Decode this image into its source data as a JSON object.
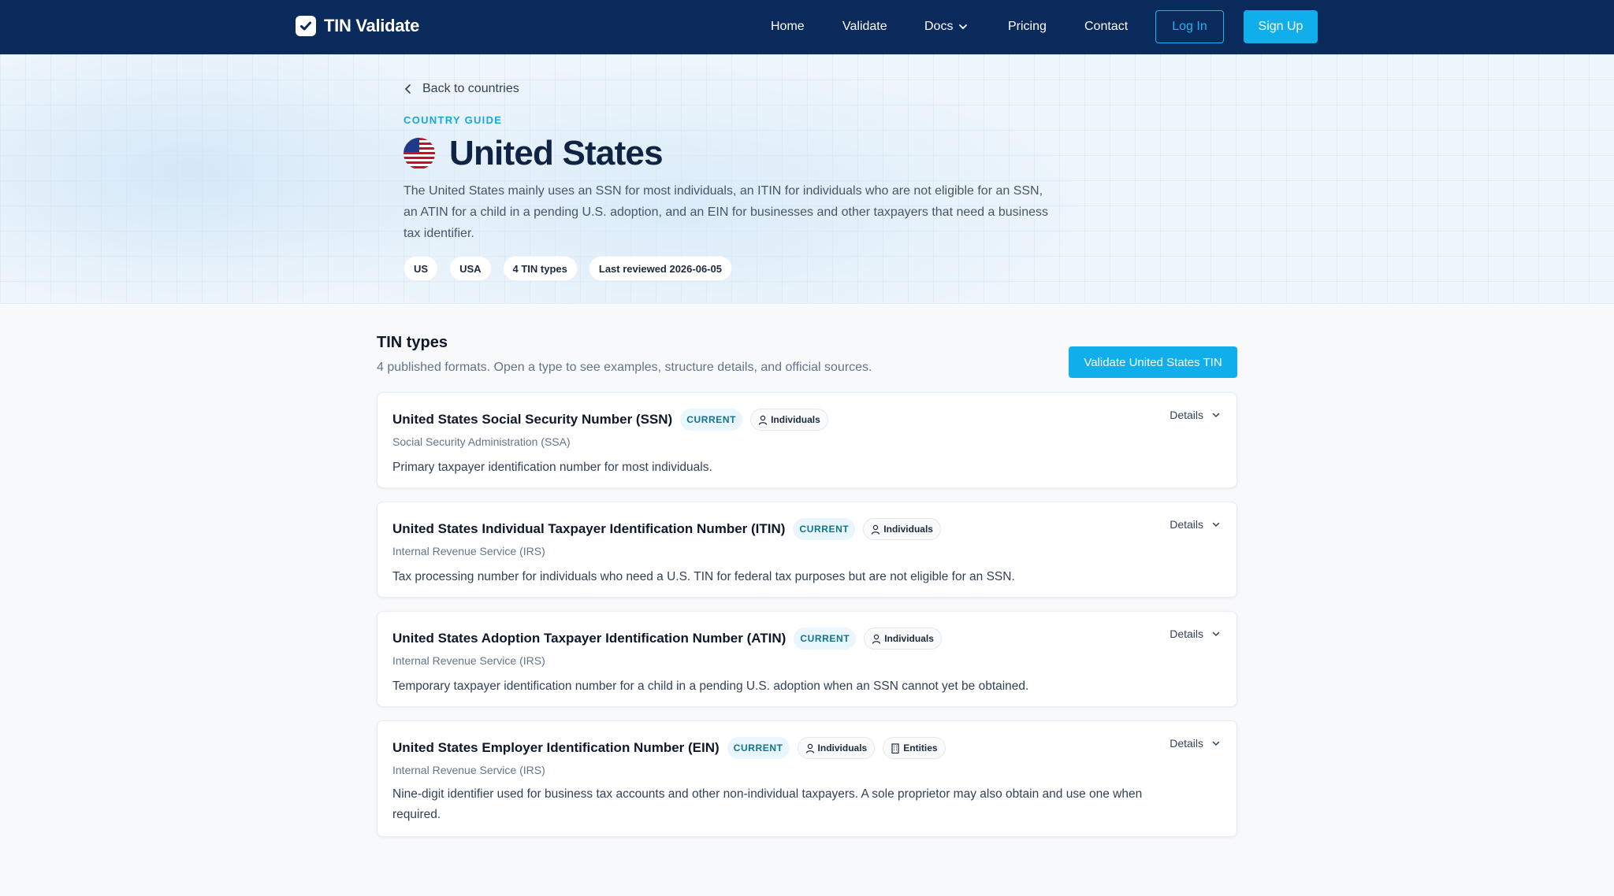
{
  "nav": {
    "brand": "TIN Validate",
    "links": [
      "Home",
      "Validate",
      "Docs",
      "Pricing",
      "Contact"
    ],
    "login": "Log In",
    "signup": "Sign Up"
  },
  "hero": {
    "back_label": "Back to countries",
    "eyebrow": "COUNTRY GUIDE",
    "title": "United States",
    "description": "The United States mainly uses an SSN for most individuals, an ITIN for individuals who are not eligible for an SSN, an ATIN for a child in a pending U.S. adoption, and an EIN for businesses and other taxpayers that need a business tax identifier.",
    "chips": [
      "US",
      "USA",
      "4 TIN types",
      "Last reviewed 2026-06-05"
    ]
  },
  "tin_types": {
    "title": "TIN types",
    "subtitle": "4 published formats. Open a type to see examples, structure details, and official sources.",
    "validate_button": "Validate United States TIN",
    "items": [
      {
        "title": "United States Social Security Number (SSN)",
        "status": "CURRENT",
        "audiences": [
          "Individuals"
        ],
        "authority": "Social Security Administration (SSA)",
        "description": "Primary taxpayer identification number for most individuals.",
        "details_label": "Details"
      },
      {
        "title": "United States Individual Taxpayer Identification Number (ITIN)",
        "status": "CURRENT",
        "audiences": [
          "Individuals"
        ],
        "authority": "Internal Revenue Service (IRS)",
        "description": "Tax processing number for individuals who need a U.S. TIN for federal tax purposes but are not eligible for an SSN.",
        "details_label": "Details"
      },
      {
        "title": "United States Adoption Taxpayer Identification Number (ATIN)",
        "status": "CURRENT",
        "audiences": [
          "Individuals"
        ],
        "authority": "Internal Revenue Service (IRS)",
        "description": "Temporary taxpayer identification number for a child in a pending U.S. adoption when an SSN cannot yet be obtained.",
        "details_label": "Details"
      },
      {
        "title": "United States Employer Identification Number (EIN)",
        "status": "CURRENT",
        "audiences": [
          "Individuals",
          "Entities"
        ],
        "authority": "Internal Revenue Service (IRS)",
        "description": "Nine-digit identifier used for business tax accounts and other non-individual taxpayers. A sole proprietor may also obtain and use one when required.",
        "details_label": "Details"
      }
    ]
  }
}
